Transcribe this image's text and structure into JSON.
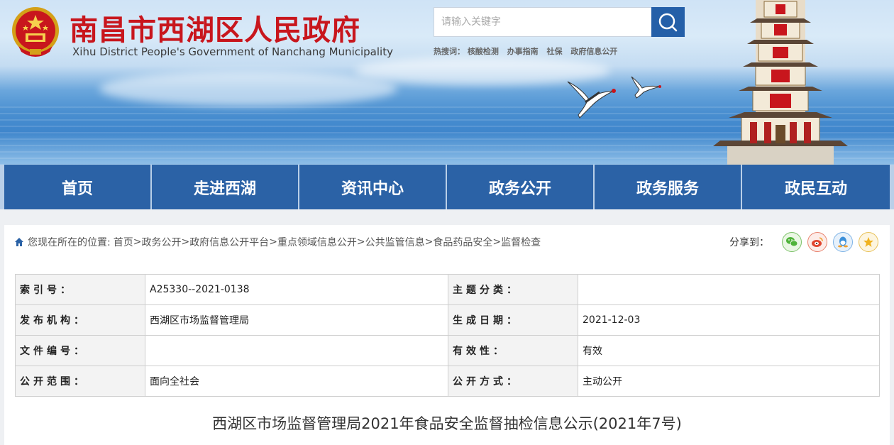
{
  "header": {
    "site_title": "南昌市西湖区人民政府",
    "site_subtitle": "Xihu District People's Government of Nanchang Municipality",
    "search_placeholder": "请输入关键字",
    "hot_label": "热搜词：",
    "hot_words": [
      "核酸检测",
      "办事指南",
      "社保",
      "政府信息公开"
    ]
  },
  "nav": {
    "items": [
      "首页",
      "走进西湖",
      "资讯中心",
      "政务公开",
      "政务服务",
      "政民互动"
    ]
  },
  "breadcrumb": {
    "prefix": "您现在所在的位置:",
    "items": [
      "首页",
      "政务公开",
      "政府信息公开平台",
      "重点领域信息公开",
      "公共监管信息",
      "食品药品安全",
      "监督检查"
    ],
    "separator": ">"
  },
  "share": {
    "label": "分享到："
  },
  "meta": {
    "rows": [
      [
        {
          "label": "索引号：",
          "value": "A25330--2021-0138"
        },
        {
          "label": "主题分类：",
          "value": ""
        }
      ],
      [
        {
          "label": "发布机构：",
          "value": "西湖区市场监督管理局"
        },
        {
          "label": "生成日期：",
          "value": "2021-12-03"
        }
      ],
      [
        {
          "label": "文件编号：",
          "value": ""
        },
        {
          "label": "有效性：",
          "value": "有效"
        }
      ],
      [
        {
          "label": "公开范围：",
          "value": "面向全社会"
        },
        {
          "label": "公开方式：",
          "value": "主动公开"
        }
      ]
    ]
  },
  "article": {
    "title": "西湖区市场监督管理局2021年食品安全监督抽检信息公示(2021年7号)"
  },
  "colors": {
    "brand_red": "#c8161d",
    "nav_blue": "#2b62a6",
    "search_blue": "#245fa8"
  }
}
